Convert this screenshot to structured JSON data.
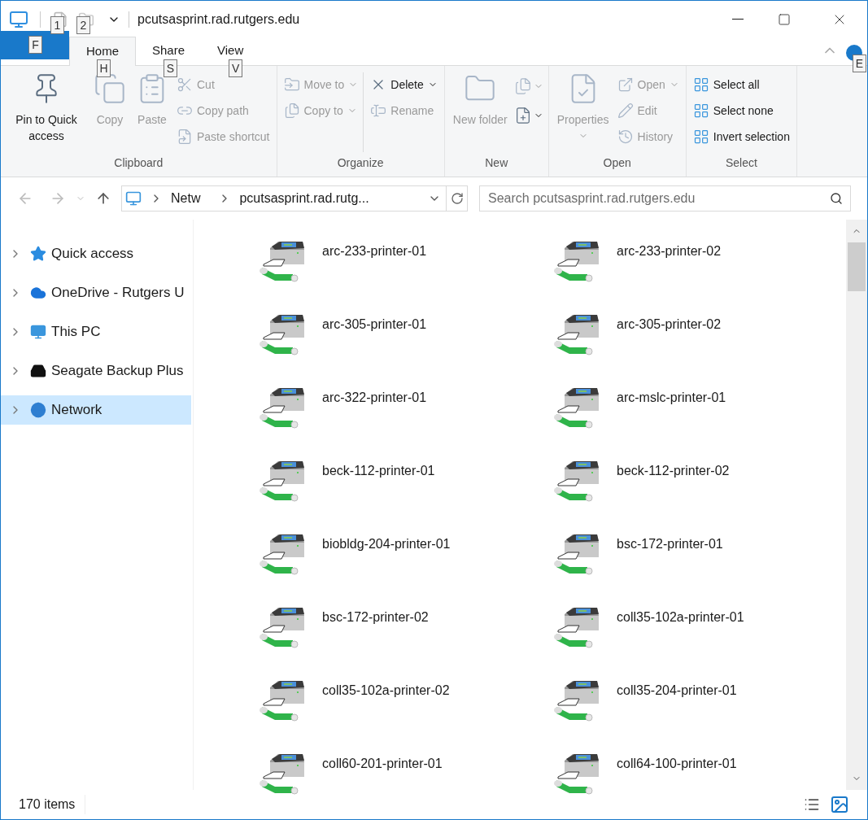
{
  "window": {
    "title": "pcutsasprint.rad.rutgers.edu"
  },
  "quick_access_toolbar": {
    "keytips": [
      "1",
      "2"
    ]
  },
  "tabs": [
    {
      "kind": "file",
      "keytip": "F",
      "selected": false
    },
    {
      "kind": "tab",
      "label": "Home",
      "keytip": "H",
      "selected": true
    },
    {
      "kind": "tab",
      "label": "Share",
      "keytip": "S",
      "selected": false
    },
    {
      "kind": "tab",
      "label": "View",
      "keytip": "V",
      "selected": false
    }
  ],
  "help_keytip": "E",
  "ribbon": {
    "groups": [
      {
        "label": "Clipboard",
        "columns": [
          [
            {
              "kind": "large",
              "label": "Pin to Quick access",
              "disabled": false
            }
          ],
          [
            {
              "kind": "large",
              "label": "Copy",
              "disabled": true
            }
          ],
          [
            {
              "kind": "large",
              "label": "Paste",
              "disabled": true
            }
          ],
          [
            {
              "kind": "small",
              "label": "Cut",
              "disabled": true
            },
            {
              "kind": "small",
              "label": "Copy path",
              "disabled": true
            },
            {
              "kind": "small",
              "label": "Paste shortcut",
              "disabled": true
            }
          ]
        ]
      },
      {
        "label": "Organize",
        "columns": [
          [
            {
              "kind": "small",
              "label": "Move to",
              "dropdown": true,
              "disabled": true
            },
            {
              "kind": "small",
              "label": "Copy to",
              "dropdown": true,
              "disabled": true
            }
          ],
          [
            {
              "kind": "small",
              "label": "Delete",
              "dropdown": true,
              "disabled": false
            },
            {
              "kind": "small",
              "label": "Rename",
              "disabled": true
            }
          ]
        ]
      },
      {
        "label": "New",
        "columns": [
          [
            {
              "kind": "large",
              "label": "New folder",
              "disabled": true
            }
          ],
          [
            {
              "kind": "icon",
              "dropdown": true,
              "disabled": true
            },
            {
              "kind": "icon",
              "dropdown": true,
              "disabled": false
            }
          ]
        ]
      },
      {
        "label": "Open",
        "columns": [
          [
            {
              "kind": "large",
              "label": "Properties",
              "dropdown": true,
              "disabled": true
            }
          ],
          [
            {
              "kind": "small",
              "label": "Open",
              "dropdown": true,
              "disabled": true
            },
            {
              "kind": "small",
              "label": "Edit",
              "disabled": true
            },
            {
              "kind": "small",
              "label": "History",
              "disabled": true
            }
          ]
        ]
      },
      {
        "label": "Select",
        "columns": [
          [
            {
              "kind": "small",
              "label": "Select all",
              "disabled": false
            },
            {
              "kind": "small",
              "label": "Select none",
              "disabled": false
            },
            {
              "kind": "small",
              "label": "Invert selection",
              "disabled": false
            }
          ]
        ]
      }
    ]
  },
  "address_bar": {
    "crumbs": [
      "Netw",
      "pcutsasprint.rad.rutg..."
    ]
  },
  "search": {
    "placeholder": "Search pcutsasprint.rad.rutgers.edu"
  },
  "sidebar": {
    "items": [
      {
        "label": "Quick access",
        "expanded": false,
        "selected": false
      },
      {
        "label": "OneDrive - Rutgers U",
        "expanded": false,
        "selected": false
      },
      {
        "label": "This PC",
        "expanded": false,
        "selected": false
      },
      {
        "label": "Seagate Backup Plus",
        "expanded": false,
        "selected": false
      },
      {
        "label": "Network",
        "expanded": false,
        "selected": true
      }
    ]
  },
  "items": [
    "arc-233-printer-01",
    "arc-233-printer-02",
    "arc-305-printer-01",
    "arc-305-printer-02",
    "arc-322-printer-01",
    "arc-mslc-printer-01",
    "beck-112-printer-01",
    "beck-112-printer-02",
    "biobldg-204-printer-01",
    "bsc-172-printer-01",
    "bsc-172-printer-02",
    "coll35-102a-printer-01",
    "coll35-102a-printer-02",
    "coll35-204-printer-01",
    "coll60-201-printer-01",
    "coll64-100-printer-01"
  ],
  "status_bar": {
    "count": "170 items"
  }
}
